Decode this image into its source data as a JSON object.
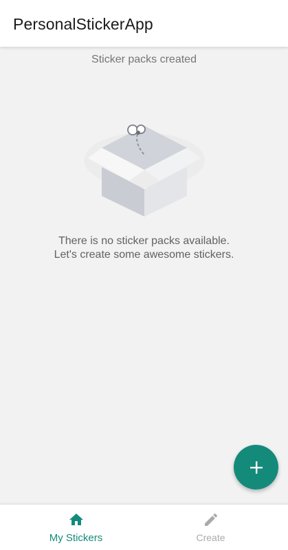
{
  "app_bar": {
    "title": "PersonalStickerApp"
  },
  "main": {
    "section_title": "Sticker packs created",
    "empty_state": {
      "line1": "There is no sticker packs available.",
      "line2": "Let's create some awesome stickers."
    }
  },
  "fab": {
    "icon": "plus-icon"
  },
  "bottom_nav": {
    "items": [
      {
        "label": "My Stickers",
        "icon": "home-icon",
        "active": true
      },
      {
        "label": "Create",
        "icon": "pencil-icon",
        "active": false
      }
    ]
  },
  "colors": {
    "accent": "#148a7b",
    "background": "#f2f2f2",
    "inactive": "#aaaaaa"
  }
}
